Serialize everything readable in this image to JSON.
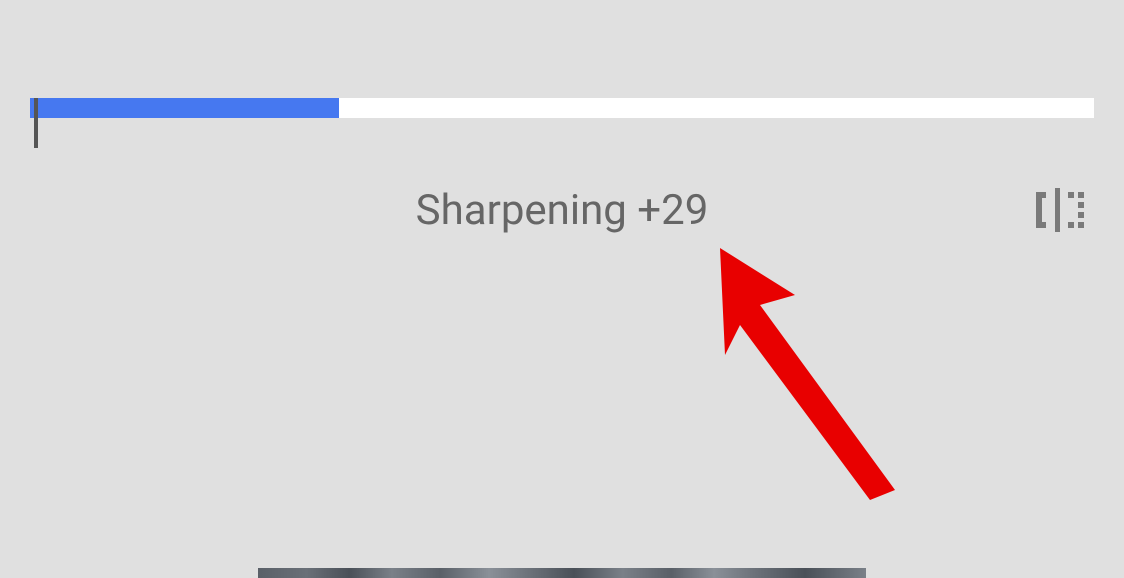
{
  "adjustment": {
    "name": "Sharpening",
    "value": 29,
    "display": "Sharpening +29",
    "slider_percent": 29
  },
  "icons": {
    "compare": "compare-split-icon"
  },
  "colors": {
    "slider_fill": "#4678f0",
    "slider_track": "#ffffff",
    "background": "#e0e0e0",
    "text": "#666666",
    "annotation_arrow": "#e80000"
  }
}
